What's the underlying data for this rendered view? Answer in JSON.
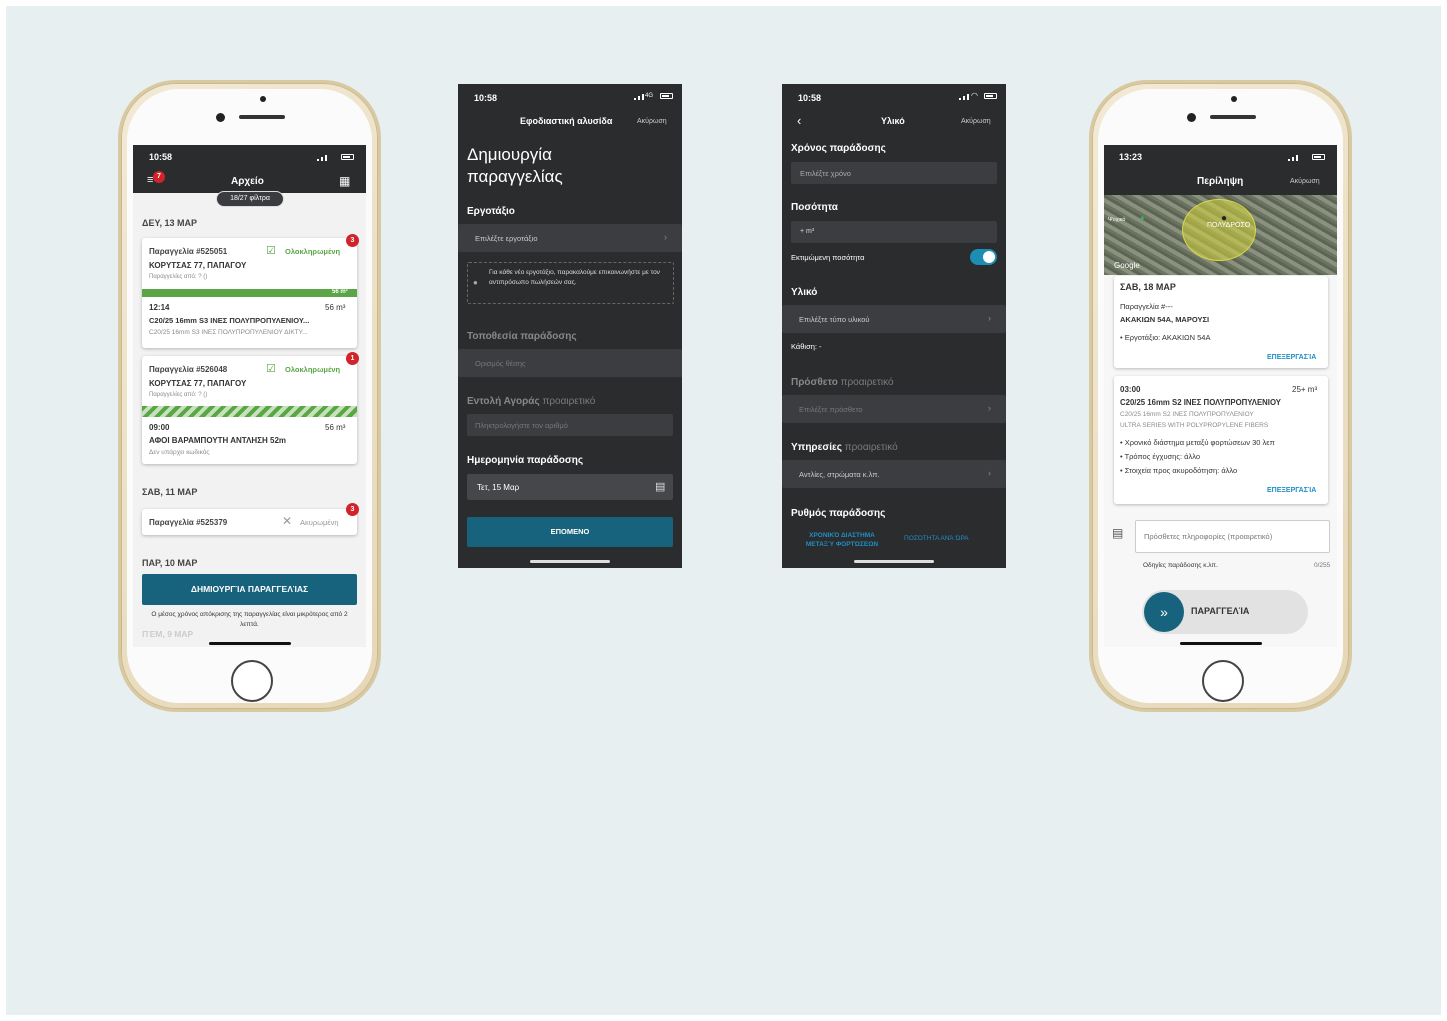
{
  "status": {
    "time_a": "10:58",
    "time_b": "13:23",
    "network": "4G"
  },
  "screen1": {
    "title": "Αρχείο",
    "filter_pill": "18/27 φίλτρα",
    "menu_badge": "7",
    "day1": "ΔΕΥ, 13 ΜΑΡ",
    "order1": {
      "badge": "3",
      "id": "Παραγγελία #525051",
      "status": "Ολοκληρωμένη",
      "address": "ΚΟΡΥΤΣΑΣ 77, ΠΑΠΑΓΟΥ",
      "from": "Παραγγελίες από: ? ()",
      "bar_value": "56 m³",
      "time": "12:14",
      "qty": "56 m³",
      "product": "C20/25 16mm S3 ΙΝΕΣ ΠΟΛΥΠΡΟΠΥΛΕΝΙΟΥ...",
      "product_sub": "C20/25 16mm S3 ΙΝΕΣ ΠΟΛΥΠΡΟΠΥΛΕΝΙΟΥ ΔΙΚΤΥ..."
    },
    "order2": {
      "badge": "1",
      "id": "Παραγγελία #526048",
      "status": "Ολοκληρωμένη",
      "address": "ΚΟΡΥΤΣΑΣ 77, ΠΑΠΑΓΟΥ",
      "from": "Παραγγελίες από: ? ()",
      "time": "09:00",
      "qty": "56 m³",
      "product": "ΑΦΟΙ ΒΑΡΑΜΠΟΥΤΗ ΑΝΤΛΗΣΗ 52m",
      "product_sub": "Δεν υπάρχει κωδικός"
    },
    "day2": "ΣΑΒ, 11 ΜΑΡ",
    "order3": {
      "badge": "3",
      "id": "Παραγγελία #525379",
      "status": "Ακυρωμένη"
    },
    "day3": "ΠΑΡ, 10 ΜΑΡ",
    "create_button": "ΔΗΜΙΟΥΡΓΊΑ ΠΑΡΑΓΓΕΛΊΑΣ",
    "info": "Ο μέσος χρόνος απόκρισης της παραγγελίας είναι μικρότερος από 2 λεπτά.",
    "day4": "ΠΈΜ, 9 ΜΑΡ"
  },
  "screen2": {
    "header": "Εφοδιαστική αλυσίδα",
    "cancel": "Ακύρωση",
    "title_line1": "Δημιουργία",
    "title_line2": "παραγγελίας",
    "site_label": "Εργοτάξιο",
    "site_placeholder": "Επιλέξτε εργοτάξιο",
    "notice": "Για κάθε νέο εργοτάξιο, παρακαλούμε επικοινωνήστε με τον αντιπρόσωπο πωλήσεών σας.",
    "location_label": "Τοποθεσία παράδοσης",
    "location_placeholder": "Ορισμός θέσης",
    "po_label": "Εντολή Αγοράς",
    "optional": "προαιρετικό",
    "po_placeholder": "Πληκτρολογήστε τον αριθμό",
    "date_label": "Ημερομηνία παράδοσης",
    "date_value": "Τετ, 15 Μαρ",
    "next_button": "ΕΠΟΜΕΝΟ"
  },
  "screen3": {
    "header": "Υλικό",
    "cancel": "Ακύρωση",
    "time_label": "Χρόνος παράδοσης",
    "time_placeholder": "Επιλέξτε χρόνο",
    "qty_label": "Ποσότητα",
    "qty_value": "+ m³",
    "estimated": "Εκτιμώμενη ποσότητα",
    "material_label": "Υλικό",
    "material_placeholder": "Επιλέξτε τύπο υλικού",
    "slump": "Κάθιση: -",
    "additive_label": "Πρόσθετο",
    "optional": "προαιρετικό",
    "additive_placeholder": "Επιλέξτε πρόσθετο",
    "services_label": "Υπηρεσίες",
    "services_placeholder": "Αντλίες, στρώματα κ.λπ.",
    "rhythm_label": "Ρυθμός παράδοσης",
    "rhythm_opt1_line1": "ΧΡΟΝΙΚΌ ΔΙΑΣΤΗΜΑ",
    "rhythm_opt1_line2": "ΜΕΤΑΞΎ ΦΟΡΤΏΣΕΩΝ",
    "rhythm_opt2": "ΠΟΣΌΤΗΤΑ ΑΝΆ ΏΡΑ"
  },
  "screen4": {
    "title": "Περίληψη",
    "cancel": "Ακύρωση",
    "map_logo": "Google",
    "map_area": "ΠΟΛΥΔΡΟΣΟ",
    "map_small": "Ψυχικό",
    "day": "ΣΑΒ, 18 ΜΑΡ",
    "order": "Παραγγελία #---",
    "address": "ΑΚΑΚΙΩΝ 54Α, ΜΑΡΟΥΣΙ",
    "site": "• Εργοτάξιο: ΑΚΑΚΙΩΝ 54Α",
    "edit": "ΕΠΕΞΕΡΓΑΣΊΑ",
    "time": "03:00",
    "qty": "25+ m³",
    "product": "C20/25 16mm S2 ΙΝΕΣ ΠΟΛΥΠΡΟΠΥΛΕΝΙΟΥ",
    "product_sub": "C20/25 16mm S2 ΙΝΕΣ ΠΟΛΥΠΡΟΠΥΛΕΝΙΟΥ",
    "product_sub2": "ULTRA SERIES WITH POLYPROPYLENE FIBERS",
    "bullet1": "• Χρονικό διάστημα μεταξύ φορτώσεων 30 λεπ",
    "bullet2": "• Τρόπος έγχυσης: άλλο",
    "bullet3": "• Στοιχεία προς ακυροδότηση: άλλο",
    "edit2": "ΕΠΕΞΕΡΓΑΣΊΑ",
    "notes_placeholder": "Πρόσθετες πληροφορίες (προαιρετικό)",
    "notes_hint": "Οδηγίες παράδοσης κ.λπ.",
    "notes_count": "0/255",
    "order_button": "ΠΑΡΑΓΓΕΛΊΑ"
  },
  "colors": {
    "accent": "#17627c",
    "dark": "#2b2c2e",
    "success": "#5aa545",
    "danger": "#d3232a",
    "link": "#1f8fc4"
  }
}
